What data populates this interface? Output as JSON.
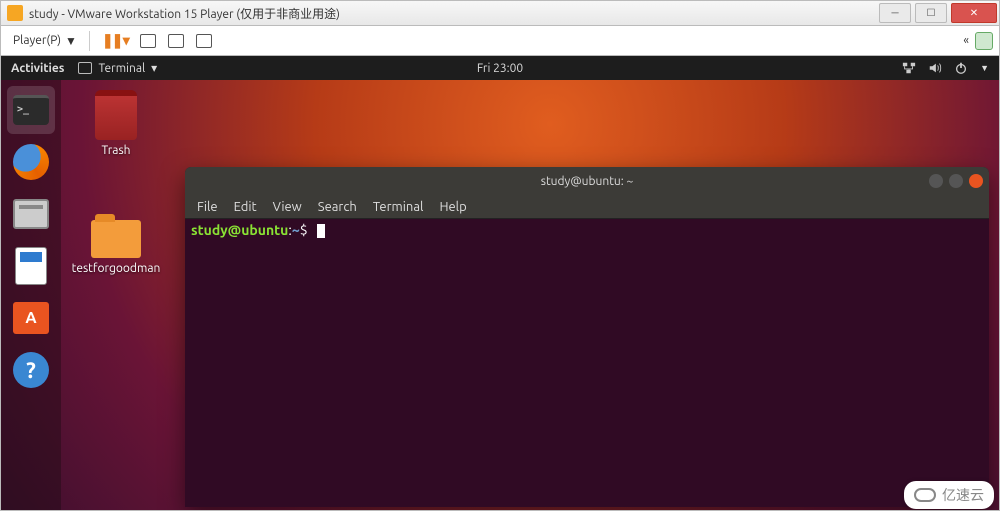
{
  "vmware": {
    "window_title": "study - VMware Workstation 15 Player (仅用于非商业用途)",
    "player_menu": "Player(P)",
    "player_dropdown": "▼"
  },
  "win_buttons": {
    "min": "─",
    "max": "☐",
    "close": "✕"
  },
  "topbar": {
    "activities": "Activities",
    "app_name": "Terminal",
    "app_dropdown": "▾",
    "clock": "Fri 23:00"
  },
  "dock": {
    "terminal": "Terminal",
    "firefox": "Firefox",
    "files": "Files",
    "writer": "LibreOffice Writer",
    "software": "Ubuntu Software",
    "software_glyph": "A",
    "help": "Help",
    "help_glyph": "?"
  },
  "desktop": {
    "trash_label": "Trash",
    "folder_label": "testforgoodman"
  },
  "terminal": {
    "title": "study@ubuntu: ~",
    "menu": [
      "File",
      "Edit",
      "View",
      "Search",
      "Terminal",
      "Help"
    ],
    "prompt_user_host": "study@ubuntu",
    "prompt_sep": ":",
    "prompt_path": "~",
    "prompt_symbol": "$"
  },
  "watermark": "亿速云"
}
